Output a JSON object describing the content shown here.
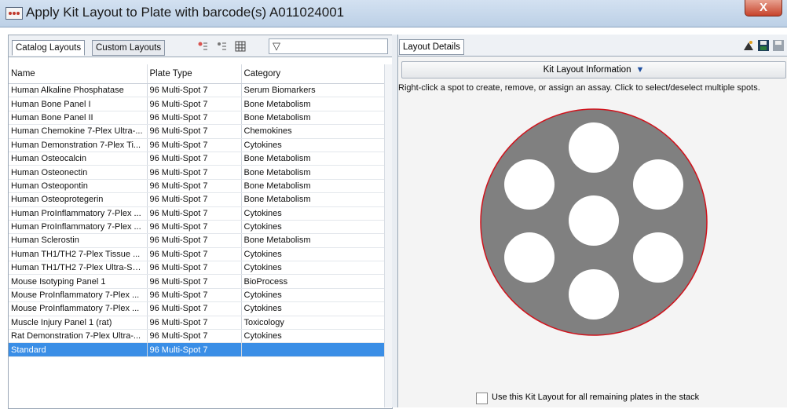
{
  "window": {
    "title": "Apply Kit Layout to Plate with barcode(s) A011024001",
    "close_glyph": "X"
  },
  "left_panel": {
    "tabs": [
      {
        "label": "Catalog Layouts",
        "active": true
      },
      {
        "label": "Custom Layouts",
        "active": false
      }
    ],
    "filter_icon": "funnel-icon",
    "columns": [
      "Name",
      "Plate Type",
      "Category"
    ],
    "rows": [
      [
        "Human Alkaline Phosphatase",
        "96 Multi-Spot 7",
        "Serum Biomarkers"
      ],
      [
        "Human Bone Panel I",
        "96 Multi-Spot 7",
        "Bone Metabolism"
      ],
      [
        "Human Bone Panel II",
        "96 Multi-Spot 7",
        "Bone Metabolism"
      ],
      [
        "Human Chemokine 7-Plex Ultra-...",
        "96 Multi-Spot 7",
        "Chemokines"
      ],
      [
        "Human Demonstration 7-Plex Ti...",
        "96 Multi-Spot 7",
        "Cytokines"
      ],
      [
        "Human Osteocalcin",
        "96 Multi-Spot 7",
        "Bone Metabolism"
      ],
      [
        "Human Osteonectin",
        "96 Multi-Spot 7",
        "Bone Metabolism"
      ],
      [
        "Human Osteopontin",
        "96 Multi-Spot 7",
        "Bone Metabolism"
      ],
      [
        "Human Osteoprotegerin",
        "96 Multi-Spot 7",
        "Bone Metabolism"
      ],
      [
        "Human ProInflammatory 7-Plex ...",
        "96 Multi-Spot 7",
        "Cytokines"
      ],
      [
        "Human ProInflammatory 7-Plex ...",
        "96 Multi-Spot 7",
        "Cytokines"
      ],
      [
        "Human Sclerostin",
        "96 Multi-Spot 7",
        "Bone Metabolism"
      ],
      [
        "Human TH1/TH2 7-Plex Tissue ...",
        "96 Multi-Spot 7",
        "Cytokines"
      ],
      [
        "Human TH1/TH2 7-Plex Ultra-Se...",
        "96 Multi-Spot 7",
        "Cytokines"
      ],
      [
        "Mouse Isotyping Panel 1",
        "96 Multi-Spot 7",
        "BioProcess"
      ],
      [
        "Mouse ProInflammatory 7-Plex ...",
        "96 Multi-Spot 7",
        "Cytokines"
      ],
      [
        "Mouse ProInflammatory 7-Plex ...",
        "96 Multi-Spot 7",
        "Cytokines"
      ],
      [
        "Muscle Injury Panel 1 (rat)",
        "96 Multi-Spot 7",
        "Toxicology"
      ],
      [
        "Rat Demonstration 7-Plex Ultra-...",
        "96 Multi-Spot 7",
        "Cytokines"
      ],
      [
        "Standard",
        "96 Multi-Spot 7",
        ""
      ]
    ],
    "selected_row": 19
  },
  "right_panel": {
    "tab_label": "Layout Details",
    "kit_info_label": "Kit Layout Information",
    "hint": "Right-click a spot to create, remove, or assign an assay. Click to select/deselect multiple spots.",
    "checkbox_label": "Use this Kit Layout for all remaining plates in the stack",
    "checkbox_checked": false
  },
  "colors": {
    "selection": "#3a8ee6",
    "well_fill": "#808080",
    "well_border": "#d0121b",
    "spot": "#ffffff"
  }
}
